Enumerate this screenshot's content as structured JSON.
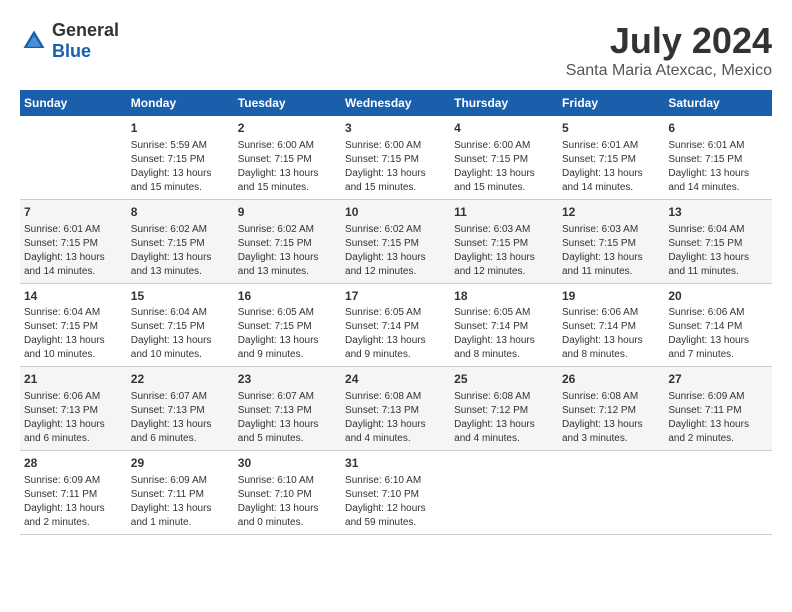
{
  "header": {
    "logo": {
      "general": "General",
      "blue": "Blue"
    },
    "title": "July 2024",
    "location": "Santa Maria Atexcac, Mexico"
  },
  "columns": [
    "Sunday",
    "Monday",
    "Tuesday",
    "Wednesday",
    "Thursday",
    "Friday",
    "Saturday"
  ],
  "weeks": [
    [
      {
        "day": "",
        "info": ""
      },
      {
        "day": "1",
        "info": "Sunrise: 5:59 AM\nSunset: 7:15 PM\nDaylight: 13 hours\nand 15 minutes."
      },
      {
        "day": "2",
        "info": "Sunrise: 6:00 AM\nSunset: 7:15 PM\nDaylight: 13 hours\nand 15 minutes."
      },
      {
        "day": "3",
        "info": "Sunrise: 6:00 AM\nSunset: 7:15 PM\nDaylight: 13 hours\nand 15 minutes."
      },
      {
        "day": "4",
        "info": "Sunrise: 6:00 AM\nSunset: 7:15 PM\nDaylight: 13 hours\nand 15 minutes."
      },
      {
        "day": "5",
        "info": "Sunrise: 6:01 AM\nSunset: 7:15 PM\nDaylight: 13 hours\nand 14 minutes."
      },
      {
        "day": "6",
        "info": "Sunrise: 6:01 AM\nSunset: 7:15 PM\nDaylight: 13 hours\nand 14 minutes."
      }
    ],
    [
      {
        "day": "7",
        "info": "Sunrise: 6:01 AM\nSunset: 7:15 PM\nDaylight: 13 hours\nand 14 minutes."
      },
      {
        "day": "8",
        "info": "Sunrise: 6:02 AM\nSunset: 7:15 PM\nDaylight: 13 hours\nand 13 minutes."
      },
      {
        "day": "9",
        "info": "Sunrise: 6:02 AM\nSunset: 7:15 PM\nDaylight: 13 hours\nand 13 minutes."
      },
      {
        "day": "10",
        "info": "Sunrise: 6:02 AM\nSunset: 7:15 PM\nDaylight: 13 hours\nand 12 minutes."
      },
      {
        "day": "11",
        "info": "Sunrise: 6:03 AM\nSunset: 7:15 PM\nDaylight: 13 hours\nand 12 minutes."
      },
      {
        "day": "12",
        "info": "Sunrise: 6:03 AM\nSunset: 7:15 PM\nDaylight: 13 hours\nand 11 minutes."
      },
      {
        "day": "13",
        "info": "Sunrise: 6:04 AM\nSunset: 7:15 PM\nDaylight: 13 hours\nand 11 minutes."
      }
    ],
    [
      {
        "day": "14",
        "info": "Sunrise: 6:04 AM\nSunset: 7:15 PM\nDaylight: 13 hours\nand 10 minutes."
      },
      {
        "day": "15",
        "info": "Sunrise: 6:04 AM\nSunset: 7:15 PM\nDaylight: 13 hours\nand 10 minutes."
      },
      {
        "day": "16",
        "info": "Sunrise: 6:05 AM\nSunset: 7:15 PM\nDaylight: 13 hours\nand 9 minutes."
      },
      {
        "day": "17",
        "info": "Sunrise: 6:05 AM\nSunset: 7:14 PM\nDaylight: 13 hours\nand 9 minutes."
      },
      {
        "day": "18",
        "info": "Sunrise: 6:05 AM\nSunset: 7:14 PM\nDaylight: 13 hours\nand 8 minutes."
      },
      {
        "day": "19",
        "info": "Sunrise: 6:06 AM\nSunset: 7:14 PM\nDaylight: 13 hours\nand 8 minutes."
      },
      {
        "day": "20",
        "info": "Sunrise: 6:06 AM\nSunset: 7:14 PM\nDaylight: 13 hours\nand 7 minutes."
      }
    ],
    [
      {
        "day": "21",
        "info": "Sunrise: 6:06 AM\nSunset: 7:13 PM\nDaylight: 13 hours\nand 6 minutes."
      },
      {
        "day": "22",
        "info": "Sunrise: 6:07 AM\nSunset: 7:13 PM\nDaylight: 13 hours\nand 6 minutes."
      },
      {
        "day": "23",
        "info": "Sunrise: 6:07 AM\nSunset: 7:13 PM\nDaylight: 13 hours\nand 5 minutes."
      },
      {
        "day": "24",
        "info": "Sunrise: 6:08 AM\nSunset: 7:13 PM\nDaylight: 13 hours\nand 4 minutes."
      },
      {
        "day": "25",
        "info": "Sunrise: 6:08 AM\nSunset: 7:12 PM\nDaylight: 13 hours\nand 4 minutes."
      },
      {
        "day": "26",
        "info": "Sunrise: 6:08 AM\nSunset: 7:12 PM\nDaylight: 13 hours\nand 3 minutes."
      },
      {
        "day": "27",
        "info": "Sunrise: 6:09 AM\nSunset: 7:11 PM\nDaylight: 13 hours\nand 2 minutes."
      }
    ],
    [
      {
        "day": "28",
        "info": "Sunrise: 6:09 AM\nSunset: 7:11 PM\nDaylight: 13 hours\nand 2 minutes."
      },
      {
        "day": "29",
        "info": "Sunrise: 6:09 AM\nSunset: 7:11 PM\nDaylight: 13 hours\nand 1 minute."
      },
      {
        "day": "30",
        "info": "Sunrise: 6:10 AM\nSunset: 7:10 PM\nDaylight: 13 hours\nand 0 minutes."
      },
      {
        "day": "31",
        "info": "Sunrise: 6:10 AM\nSunset: 7:10 PM\nDaylight: 12 hours\nand 59 minutes."
      },
      {
        "day": "",
        "info": ""
      },
      {
        "day": "",
        "info": ""
      },
      {
        "day": "",
        "info": ""
      }
    ]
  ]
}
